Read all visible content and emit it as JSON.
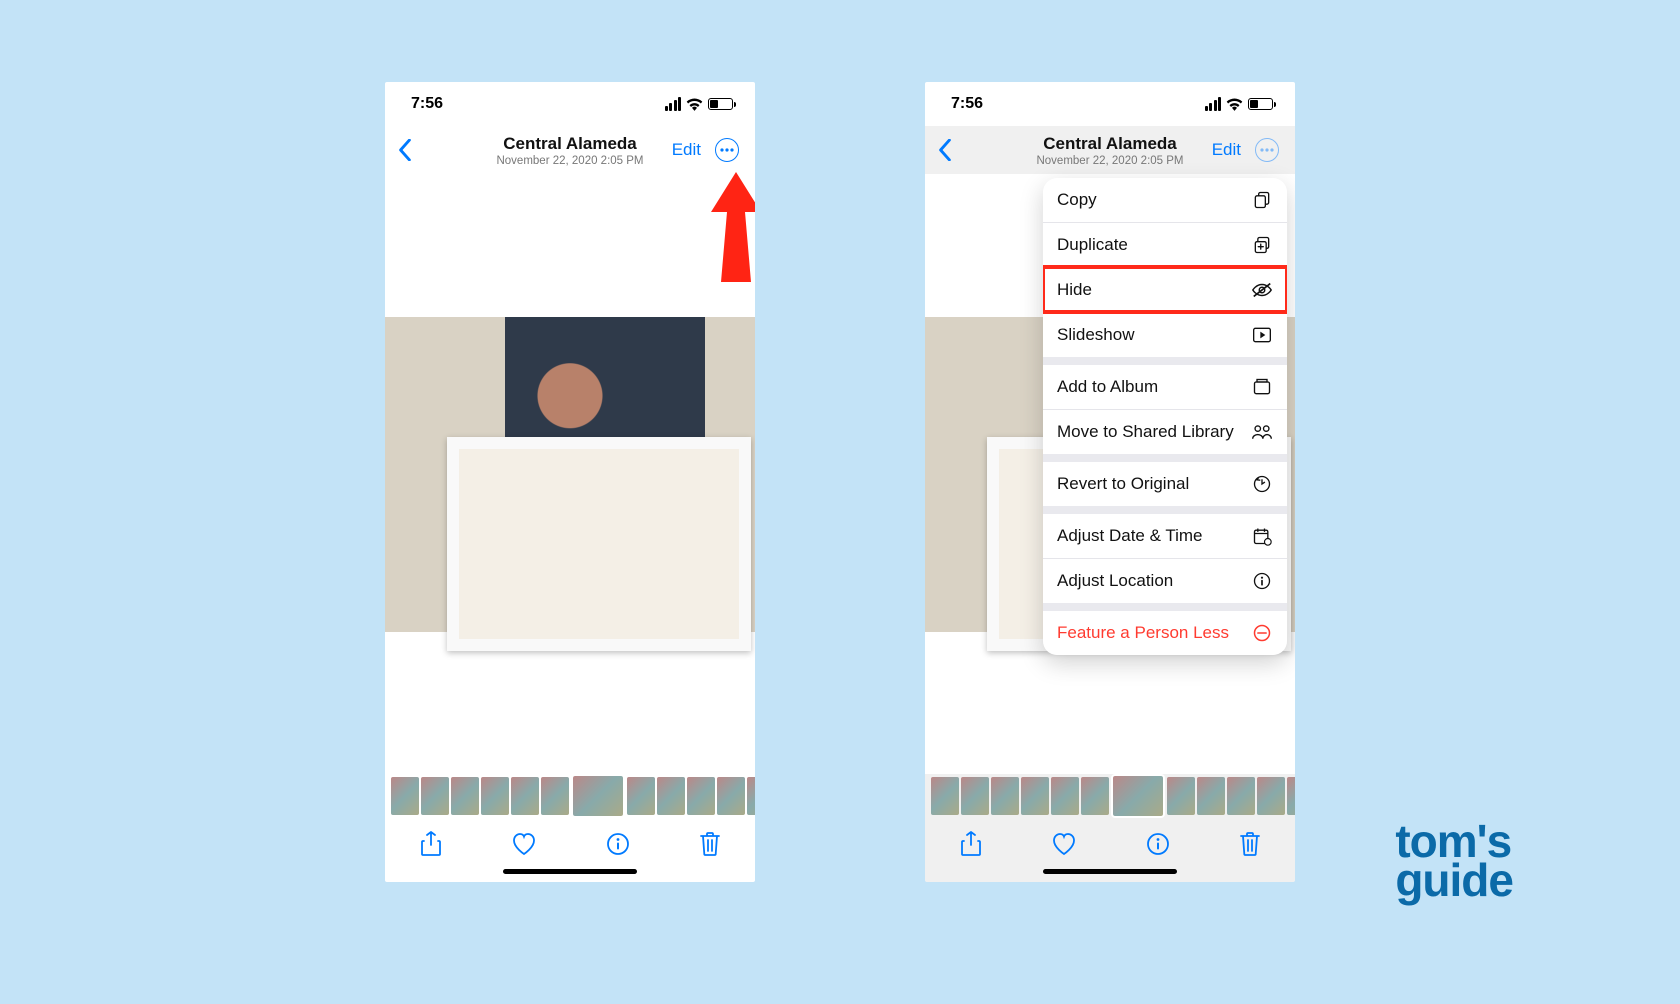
{
  "statusbar": {
    "time": "7:56"
  },
  "nav": {
    "title": "Central Alameda",
    "subtitle": "November 22, 2020  2:05 PM",
    "edit": "Edit"
  },
  "menu": {
    "items": [
      {
        "label": "Copy",
        "icon": "copy-icon"
      },
      {
        "label": "Duplicate",
        "icon": "duplicate-icon"
      },
      {
        "label": "Hide",
        "icon": "hide-icon",
        "highlight": true
      },
      {
        "label": "Slideshow",
        "icon": "slideshow-icon"
      }
    ],
    "items2": [
      {
        "label": "Add to Album",
        "icon": "album-icon"
      },
      {
        "label": "Move to Shared Library",
        "icon": "people-icon"
      }
    ],
    "items3": [
      {
        "label": "Revert to Original",
        "icon": "revert-icon"
      }
    ],
    "items4": [
      {
        "label": "Adjust Date & Time",
        "icon": "calendar-icon"
      },
      {
        "label": "Adjust Location",
        "icon": "location-icon"
      }
    ],
    "items5": [
      {
        "label": "Feature a Person Less",
        "icon": "minus-circle-icon",
        "danger": true
      }
    ]
  },
  "logo": {
    "line1": "tom's",
    "line2": "guide"
  }
}
